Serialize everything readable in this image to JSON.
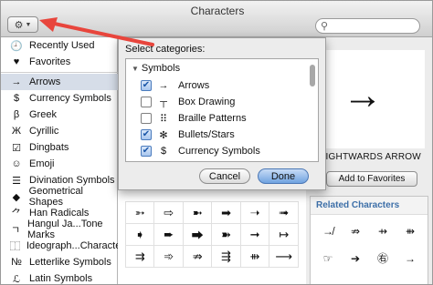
{
  "window": {
    "title": "Characters"
  },
  "toolbar": {
    "gear_icon": "gear-icon",
    "dropdown_icon": "chevron-down-icon",
    "search_icon": "search-icon"
  },
  "sidebar": {
    "items": [
      {
        "label": "Recently Used",
        "icon": "clock-icon",
        "glyph": "🕘"
      },
      {
        "label": "Favorites",
        "icon": "heart-icon",
        "glyph": "♥"
      },
      {
        "label": "Arrows",
        "icon": "arrow-icon",
        "glyph": "→"
      },
      {
        "label": "Currency Symbols",
        "icon": "dollar-icon",
        "glyph": "$"
      },
      {
        "label": "Greek",
        "icon": "beta-icon",
        "glyph": "β"
      },
      {
        "label": "Cyrillic",
        "icon": "zhe-icon",
        "glyph": "Ж"
      },
      {
        "label": "Dingbats",
        "icon": "checkbox-icon",
        "glyph": "☑"
      },
      {
        "label": "Emoji",
        "icon": "smiley-icon",
        "glyph": "☺"
      },
      {
        "label": "Divination Symbols",
        "icon": "trigram-icon",
        "glyph": "☰"
      },
      {
        "label": "Geometrical Shapes",
        "icon": "diamond-icon",
        "glyph": "◆"
      },
      {
        "label": "Han Radicals",
        "icon": "han-icon",
        "glyph": "⺈"
      },
      {
        "label": "Hangul Ja...Tone Marks",
        "icon": "hangul-icon",
        "glyph": "ㄱ"
      },
      {
        "label": "Ideograph...Characters",
        "icon": "ideograph-icon",
        "glyph": "⿰"
      },
      {
        "label": "Letterlike Symbols",
        "icon": "numero-icon",
        "glyph": "№"
      },
      {
        "label": "Latin Symbols",
        "icon": "latin-icon",
        "glyph": "ℒ"
      }
    ],
    "selected_index": 2
  },
  "popover": {
    "title": "Select categories:",
    "group_label": "Symbols",
    "items": [
      {
        "label": "Arrows",
        "glyph": "→",
        "checked": true
      },
      {
        "label": "Box Drawing",
        "glyph": "┬",
        "checked": false
      },
      {
        "label": "Braille Patterns",
        "glyph": "⠿",
        "checked": false
      },
      {
        "label": "Bullets/Stars",
        "glyph": "✻",
        "checked": true
      },
      {
        "label": "Currency Symbols",
        "glyph": "$",
        "checked": true
      }
    ],
    "cancel_label": "Cancel",
    "done_label": "Done"
  },
  "preview": {
    "glyph": "→",
    "name": "RIGHTWARDS ARROW",
    "add_favorites_label": "Add to Favorites"
  },
  "grid_glyphs": [
    [
      "➳",
      "⇨",
      "➼",
      "➡",
      "➝",
      "➟"
    ],
    [
      "➧",
      "➨",
      "⮕",
      "➽",
      "➞",
      "↦"
    ],
    [
      "⇉",
      "➾",
      "⇏",
      "⇶",
      "⇻",
      "⟶"
    ]
  ],
  "related": {
    "title": "Related Characters",
    "glyphs": [
      [
        "↛",
        "⇏",
        "⇸",
        "⇻"
      ],
      [
        "☞",
        "➔",
        "㊨",
        "→"
      ]
    ]
  }
}
